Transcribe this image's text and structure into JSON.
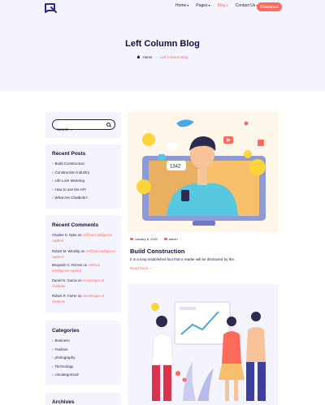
{
  "header": {
    "logo_icon": "brand-logo-icon",
    "nav": [
      {
        "label": "Home",
        "caret": "▾",
        "active": false
      },
      {
        "label": "Pages",
        "caret": "▾",
        "active": false
      },
      {
        "label": "Blog",
        "caret": "▾",
        "active": true
      },
      {
        "label": "Contact Us",
        "caret": "▾",
        "active": false
      }
    ],
    "download_label": "Download"
  },
  "hero": {
    "title": "Left Column Blog",
    "breadcrumb": {
      "home": "Home",
      "separator": "-",
      "current": "Left Column Blog"
    }
  },
  "sidebar": {
    "search": {
      "placeholder": "Search ...",
      "value": ""
    },
    "recent_posts": {
      "title": "Recent Posts",
      "items": [
        "Build Construction",
        "Construction Industry",
        "Life Lock Meaning",
        "How to use the API",
        "What Are Chatbots?"
      ]
    },
    "recent_comments": {
      "title": "Recent Comments",
      "items": [
        {
          "author": "Charles N. Dyke",
          "on": "on",
          "post": "Artificial Intelligence Applied"
        },
        {
          "author": "Robert M. Winship",
          "on": "on",
          "post": "Artificial Intelligence Applied"
        },
        {
          "author": "Benjamin C. Romos",
          "on": "on",
          "post": "Artificial Intelligence Applied"
        },
        {
          "author": "Daniel N. Garcia",
          "on": "on",
          "post": "Advantages of chatbots"
        },
        {
          "author": "Robert R. Farrer",
          "on": "on",
          "post": "Advantages of chatbots"
        }
      ]
    },
    "categories": {
      "title": "Categories",
      "items": [
        "Business",
        "Fashion",
        "photography",
        "Technology",
        "Uncategorized"
      ]
    },
    "archives": {
      "title": "Archives"
    }
  },
  "posts": [
    {
      "date": "January 6, 2022",
      "author": "admin",
      "title": "Build Construction",
      "excerpt": "It is a long established fact that a reader will be distracted by the.",
      "read_more": "Read More ›",
      "image_badge": "1342"
    }
  ],
  "colors": {
    "accent": "#ff6a5b",
    "hero_bg": "#f3f4fd",
    "text_dark": "#14113d"
  }
}
